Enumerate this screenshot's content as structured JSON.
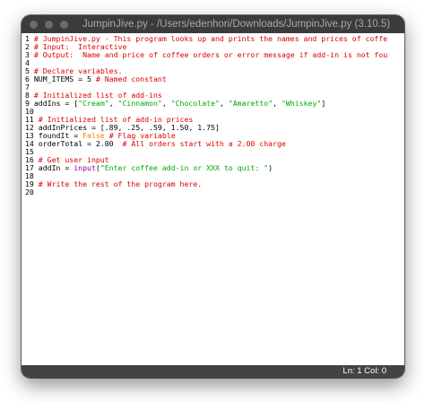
{
  "window": {
    "title": "JumpinJive.py - /Users/edenhori/Downloads/JumpinJive.py (3.10.5)"
  },
  "editor": {
    "lines": [
      {
        "num": "1",
        "tokens": [
          {
            "t": "# JumpinJive.py - This program looks up and prints the names and prices of coffe",
            "c": "comment"
          }
        ]
      },
      {
        "num": "2",
        "tokens": [
          {
            "t": "# Input:  Interactive",
            "c": "comment"
          }
        ]
      },
      {
        "num": "3",
        "tokens": [
          {
            "t": "# Output:  Name and price of coffee orders or error message if add-in is not fou",
            "c": "comment"
          }
        ]
      },
      {
        "num": "4",
        "tokens": []
      },
      {
        "num": "5",
        "tokens": [
          {
            "t": "# Declare variables.",
            "c": "comment"
          }
        ]
      },
      {
        "num": "6",
        "tokens": [
          {
            "t": "NUM_ITEMS = 5 ",
            "c": "plain"
          },
          {
            "t": "# Named constant",
            "c": "comment"
          }
        ]
      },
      {
        "num": "7",
        "tokens": []
      },
      {
        "num": "8",
        "tokens": [
          {
            "t": "# Initialized list of add-ins",
            "c": "comment"
          }
        ]
      },
      {
        "num": "9",
        "tokens": [
          {
            "t": "addIns = [",
            "c": "plain"
          },
          {
            "t": "\"Cream\"",
            "c": "string"
          },
          {
            "t": ", ",
            "c": "plain"
          },
          {
            "t": "\"Cinnamon\"",
            "c": "string"
          },
          {
            "t": ", ",
            "c": "plain"
          },
          {
            "t": "\"Chocolate\"",
            "c": "string"
          },
          {
            "t": ", ",
            "c": "plain"
          },
          {
            "t": "\"Amaretto\"",
            "c": "string"
          },
          {
            "t": ", ",
            "c": "plain"
          },
          {
            "t": "\"Whiskey\"",
            "c": "string"
          },
          {
            "t": "]",
            "c": "plain"
          }
        ]
      },
      {
        "num": "10",
        "tokens": []
      },
      {
        "num": "11",
        "tokens": [
          {
            "t": "# Initialized list of add-in prices",
            "c": "comment"
          }
        ]
      },
      {
        "num": "12",
        "tokens": [
          {
            "t": "addInPrices = [.89, .25, .59, 1.50, 1.75]",
            "c": "plain"
          }
        ]
      },
      {
        "num": "13",
        "tokens": [
          {
            "t": "foundIt = ",
            "c": "plain"
          },
          {
            "t": "False",
            "c": "keyword"
          },
          {
            "t": " ",
            "c": "plain"
          },
          {
            "t": "# Flag variable",
            "c": "comment"
          }
        ]
      },
      {
        "num": "14",
        "tokens": [
          {
            "t": "orderTotal = 2.00  ",
            "c": "plain"
          },
          {
            "t": "# All orders start with a 2.00 charge",
            "c": "comment"
          }
        ]
      },
      {
        "num": "15",
        "tokens": []
      },
      {
        "num": "16",
        "tokens": [
          {
            "t": "# Get user input",
            "c": "comment"
          }
        ]
      },
      {
        "num": "17",
        "tokens": [
          {
            "t": "addIn = ",
            "c": "plain"
          },
          {
            "t": "input",
            "c": "builtin"
          },
          {
            "t": "(",
            "c": "plain"
          },
          {
            "t": "\"Enter coffee add-in or XXX to quit: \"",
            "c": "string"
          },
          {
            "t": ")",
            "c": "plain"
          }
        ]
      },
      {
        "num": "18",
        "tokens": []
      },
      {
        "num": "19",
        "tokens": [
          {
            "t": "# Write the rest of the program here.",
            "c": "comment"
          }
        ]
      },
      {
        "num": "20",
        "tokens": []
      }
    ]
  },
  "status": {
    "position": "Ln: 1  Col: 0"
  },
  "colors": {
    "comment": "#dd0000",
    "string": "#00aa00",
    "builtin": "#900090",
    "keyword": "#ff7700",
    "titlebar": "#3b3b3d",
    "statusbar": "#434345"
  }
}
